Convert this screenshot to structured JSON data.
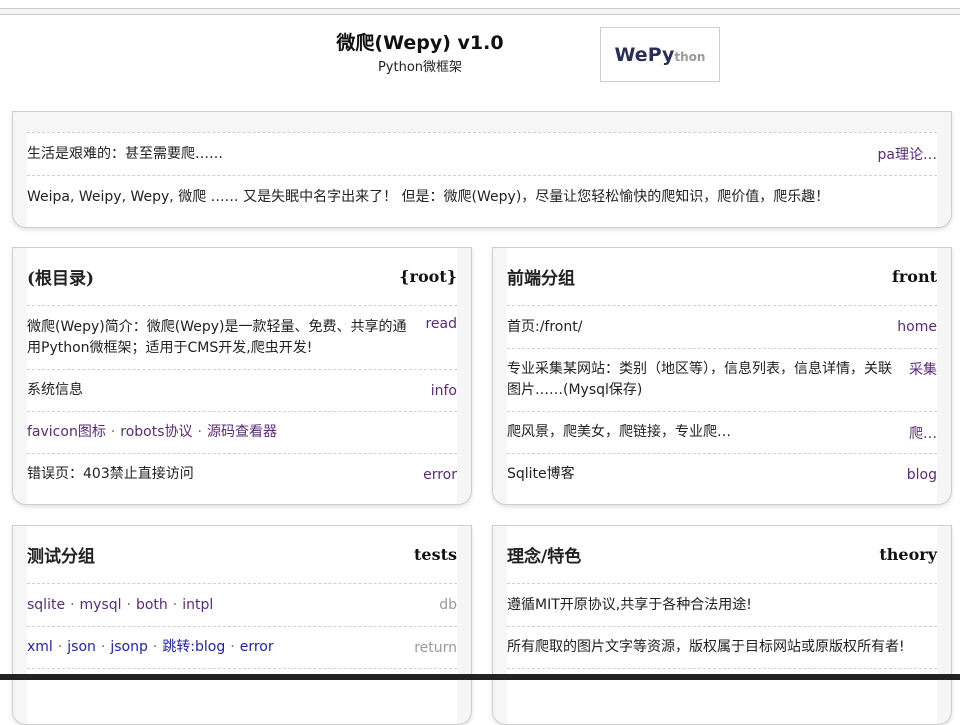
{
  "header": {
    "title": "微爬(Wepy) v1.0",
    "subtitle": "Python微框架",
    "logo_big": "WePy",
    "logo_small": "thon"
  },
  "intro": {
    "row1_text": "生活是艰难的：甚至需要爬……",
    "row1_link": "pa理论…",
    "row2_text": "Weipa, Weipy, Wepy, 微爬 …… 又是失眠中名字出来了！ 但是：微爬(Wepy)，尽量让您轻松愉快的爬知识，爬价值，爬乐趣！"
  },
  "root": {
    "title": "(根目录)",
    "key": "{root}",
    "rows": [
      {
        "text": "微爬(Wepy)简介：微爬(Wepy)是一款轻量、免费、共享的通用Python微框架；适用于CMS开发,爬虫开发!",
        "link": "read"
      },
      {
        "text": "系统信息",
        "link": "info"
      },
      {
        "links": [
          "favicon图标",
          "robots协议",
          "源码查看器"
        ]
      },
      {
        "text": "错误页：403禁止直接访问",
        "link": "error"
      }
    ]
  },
  "front": {
    "title": "前端分组",
    "key": "front",
    "rows": [
      {
        "text": "首页:/front/",
        "link": "home"
      },
      {
        "text": "专业采集某网站：类别（地区等），信息列表，信息详情，关联图片……(Mysql保存)",
        "link": "采集"
      },
      {
        "text": "爬风景，爬美女，爬链接，专业爬…",
        "link": "爬…"
      },
      {
        "text": "Sqlite博客",
        "link": "blog"
      }
    ]
  },
  "tests": {
    "title": "测试分组",
    "key": "tests",
    "rows": [
      {
        "links": [
          "sqlite",
          "mysql",
          "both",
          "intpl"
        ],
        "right": "db"
      },
      {
        "links": [
          "xml",
          "json",
          "jsonp",
          "跳转:blog",
          "error"
        ],
        "right": "return"
      }
    ]
  },
  "theory": {
    "title": "理念/特色",
    "key": "theory",
    "rows": [
      {
        "text": "遵循MIT开原协议,共享于各种合法用途!"
      },
      {
        "text": "所有爬取的图片文字等资源，版权属于目标网站或原版权所有者!"
      }
    ]
  }
}
